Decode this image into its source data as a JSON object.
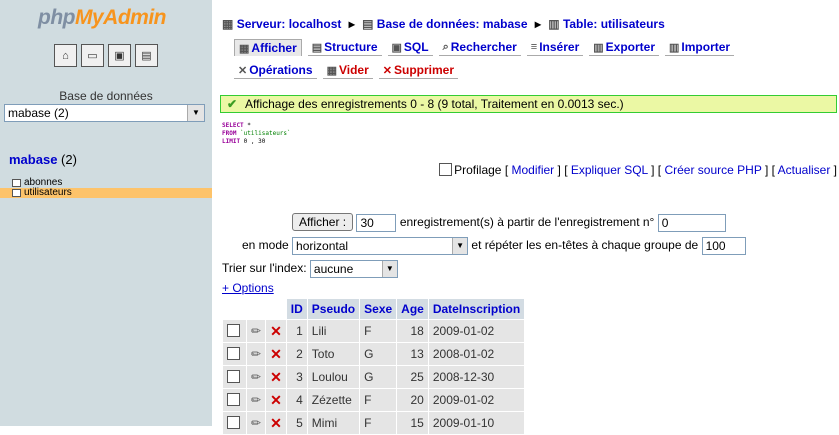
{
  "sidebar": {
    "logo": {
      "part1": "php",
      "part2": "MyAdmin"
    },
    "icons": [
      "home-icon",
      "sql-icon",
      "query-window-icon",
      "docs-icon"
    ],
    "db_label": "Base de données",
    "db_select": "mabase (2)",
    "db_title": "mabase",
    "db_count": "(2)",
    "tables": [
      {
        "name": "abonnes",
        "selected": false
      },
      {
        "name": "utilisateurs",
        "selected": true
      }
    ]
  },
  "breadcrumb": {
    "server": "Serveur: localhost",
    "database": "Base de données: mabase",
    "table": "Table: utilisateurs"
  },
  "tabs": [
    {
      "label": "Afficher",
      "icon": "browse-icon",
      "active": true
    },
    {
      "label": "Structure",
      "icon": "structure-icon"
    },
    {
      "label": "SQL",
      "icon": "sql-icon"
    },
    {
      "label": "Rechercher",
      "icon": "search-icon"
    },
    {
      "label": "Insérer",
      "icon": "insert-icon"
    },
    {
      "label": "Exporter",
      "icon": "export-icon"
    },
    {
      "label": "Importer",
      "icon": "import-icon"
    },
    {
      "label": "Opérations",
      "icon": "operations-icon"
    },
    {
      "label": "Vider",
      "icon": "empty-icon",
      "danger": true
    },
    {
      "label": "Supprimer",
      "icon": "drop-icon",
      "danger": true
    }
  ],
  "notice": "Affichage des enregistrements 0 - 8 (9 total, Traitement en 0.0013 sec.)",
  "sql": {
    "line1_kw": "SELECT",
    "line1": " *",
    "line2_kw": "FROM",
    "line2": " `utilisateurs`",
    "line3_kw": "LIMIT",
    "line3": " 0 , 30"
  },
  "query_links": {
    "profiling": "Profilage",
    "modify": "Modifier",
    "explain": "Expliquer SQL",
    "php_code": "Créer source PHP",
    "refresh": "Actualiser"
  },
  "navigation": {
    "show_button": "Afficher :",
    "rows": "30",
    "rows_text": "enregistrement(s) à partir de l'enregistrement n°",
    "start": "0",
    "mode_label": "en mode",
    "mode": "horizontal",
    "repeat_text": "et répéter les en-têtes à chaque groupe de",
    "repeat": "100",
    "sort_label": "Trier sur l'index:",
    "sort_value": "aucune",
    "options": "+ Options"
  },
  "table": {
    "columns": [
      "ID",
      "Pseudo",
      "Sexe",
      "Age",
      "DateInscription"
    ],
    "rows": [
      [
        "1",
        "Lili",
        "F",
        "18",
        "2009-01-02"
      ],
      [
        "2",
        "Toto",
        "G",
        "13",
        "2008-01-02"
      ],
      [
        "3",
        "Loulou",
        "G",
        "25",
        "2008-12-30"
      ],
      [
        "4",
        "Zézette",
        "F",
        "20",
        "2009-01-02"
      ],
      [
        "5",
        "Mimi",
        "F",
        "15",
        "2009-01-10"
      ]
    ]
  }
}
